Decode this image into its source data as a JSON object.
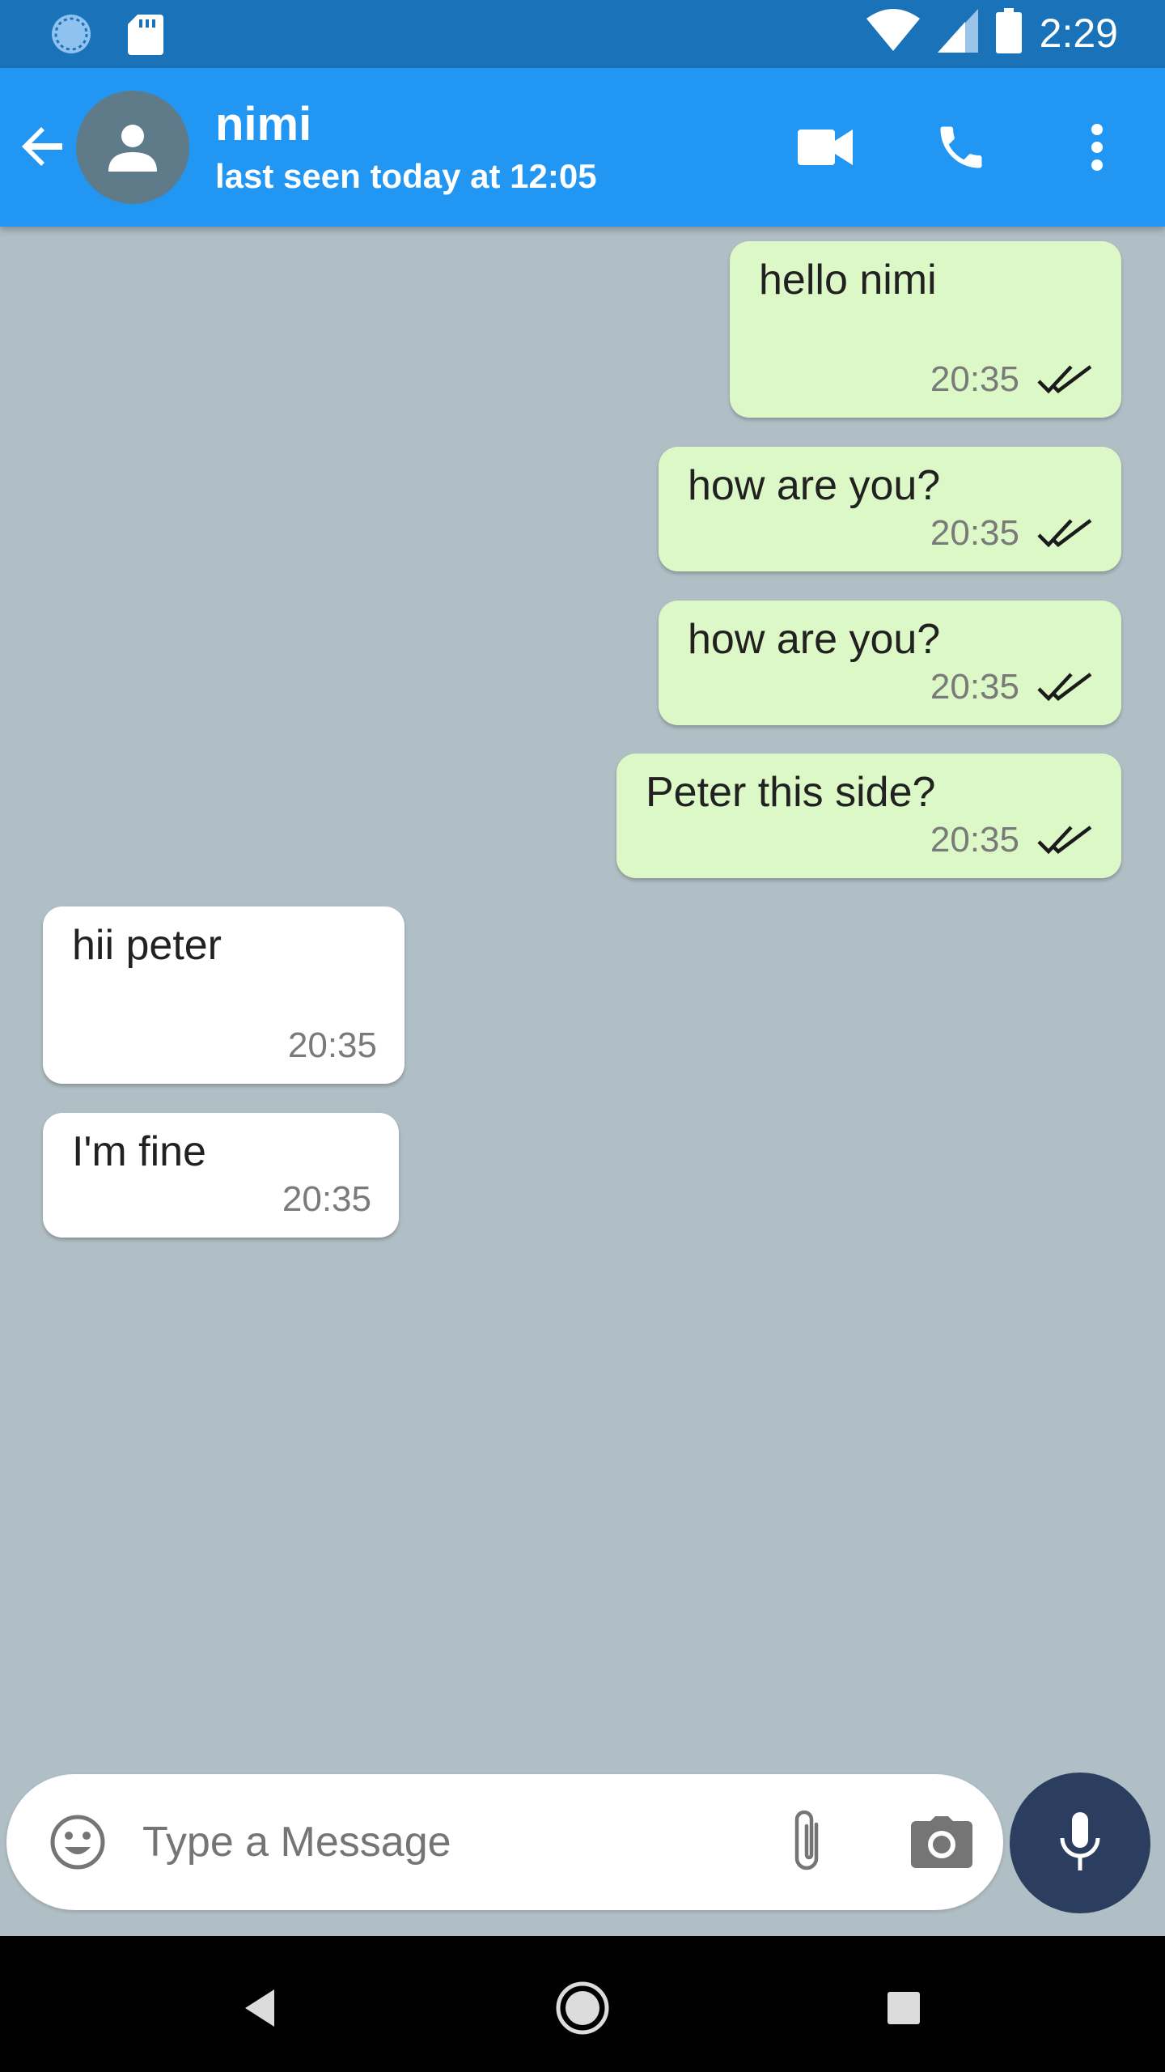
{
  "status_bar": {
    "time": "2:29",
    "icons": [
      "sync-icon",
      "sd-card-icon",
      "wifi-icon",
      "signal-icon",
      "battery-icon"
    ]
  },
  "app_bar": {
    "contact_name": "nimi",
    "last_seen": "last seen today at 12:05",
    "icons": [
      "back-arrow-icon",
      "person-icon",
      "video-call-icon",
      "phone-icon",
      "more-vert-icon"
    ],
    "color": "#2196f3"
  },
  "messages": [
    {
      "direction": "outgoing",
      "text": "hello nimi",
      "time": "20:35",
      "status": "double-check-icon"
    },
    {
      "direction": "outgoing",
      "text": "how are you?",
      "time": "20:35",
      "status": "double-check-icon"
    },
    {
      "direction": "outgoing",
      "text": "how are you?",
      "time": "20:35",
      "status": "double-check-icon"
    },
    {
      "direction": "outgoing",
      "text": "Peter this side?",
      "time": "20:35",
      "status": "double-check-icon"
    },
    {
      "direction": "incoming",
      "text": "hii peter",
      "time": "20:35"
    },
    {
      "direction": "incoming",
      "text": "I'm fine",
      "time": "20:35"
    }
  ],
  "composer": {
    "placeholder": "Type a Message",
    "icons": [
      "emoji-icon",
      "attach-icon",
      "camera-icon",
      "mic-icon"
    ]
  },
  "colors": {
    "chat_background": "#b0bec5",
    "outgoing_bubble": "#dcf8c6",
    "incoming_bubble": "#ffffff",
    "mic_button": "#2c3e5f"
  }
}
